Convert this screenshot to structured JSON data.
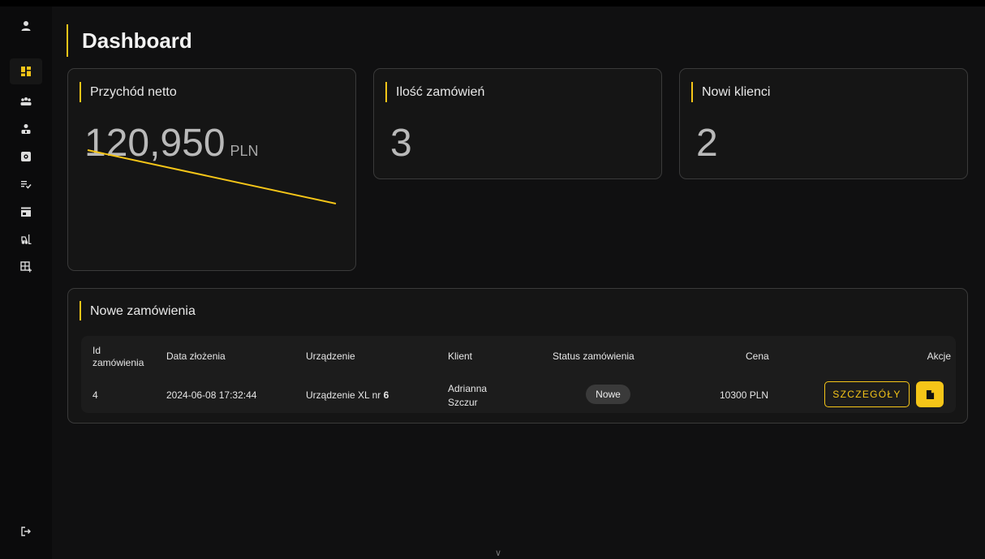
{
  "colors": {
    "accent": "#f5c518",
    "background": "#101011",
    "card": "#151515",
    "border": "#3a3a3a"
  },
  "sidebar": {
    "items": [
      {
        "icon": "user-icon"
      },
      {
        "icon": "dashboard-icon",
        "active": true
      },
      {
        "icon": "users-group-icon"
      },
      {
        "icon": "employee-icon"
      },
      {
        "icon": "settings-box-icon"
      },
      {
        "icon": "checklist-icon"
      },
      {
        "icon": "store-icon"
      },
      {
        "icon": "forklift-icon"
      },
      {
        "icon": "table-add-icon"
      }
    ],
    "logout_icon": "logout-icon"
  },
  "page": {
    "title": "Dashboard"
  },
  "stats": {
    "revenue": {
      "label": "Przychód netto",
      "value": "120,950",
      "unit": "PLN"
    },
    "orders_count": {
      "label": "Ilość zamówień",
      "value": "3"
    },
    "new_clients": {
      "label": "Nowi klienci",
      "value": "2"
    }
  },
  "revenue_trend": {
    "type": "line",
    "values": [
      1.0,
      0.0
    ]
  },
  "orders": {
    "title": "Nowe zamówienia",
    "headers": {
      "id_line1": "Id",
      "id_line2": "zamówienia",
      "date": "Data złożenia",
      "device": "Urządzenie",
      "client": "Klient",
      "status": "Status zamówienia",
      "price": "Cena",
      "actions": "Akcje"
    },
    "rows": [
      {
        "id": "4",
        "date": "2024-06-08 17:32:44",
        "device": "Urządzenie XL nr",
        "device_no": "6",
        "client_line1": "Adrianna",
        "client_line2": "Szczur",
        "status": "Nowe",
        "price": "10300 PLN",
        "details_label": "SZCZEGÓŁY"
      }
    ]
  },
  "footer": {
    "scroll_glyph": "∨"
  }
}
